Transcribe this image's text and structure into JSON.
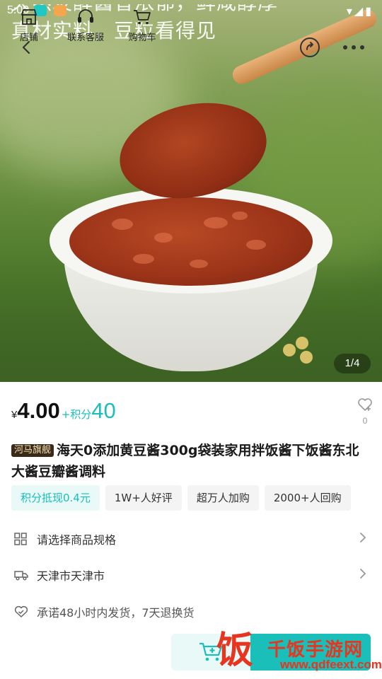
{
  "status_bar": {
    "time": "5:00"
  },
  "hero": {
    "headline_line1": "天然发酵酱香浓郁，鲜咸醇厚",
    "headline_line2": "真材实料，豆粒看得见",
    "image_counter": "1/4"
  },
  "product": {
    "currency": "¥",
    "price": "4.00",
    "points_plus": "+积分",
    "points": "40",
    "favorite_count": "0",
    "store_badge": "河马旗舰",
    "title": "海天0添加黄豆酱300g袋装家用拌饭酱下饭酱东北大酱豆瓣酱调料",
    "tags": [
      "积分抵现0.4元",
      "1W+人好评",
      "超万人加购",
      "2000+人回购"
    ]
  },
  "rows": {
    "spec": "请选择商品规格",
    "address": "天津市天津市",
    "promise": "承诺48小时内发货，7天退换货"
  },
  "bottom_bar": {
    "store": "店铺",
    "service": "联系客服",
    "cart": "购物车"
  },
  "watermark": {
    "big_char": "饭",
    "name": "千饭手游网",
    "url": "www.qdfeext.com"
  },
  "colors": {
    "accent": "#19bfb8",
    "badge_bg": "#3a2a1a",
    "watermark": "#e8351f"
  },
  "icons": [
    "back-icon",
    "share-icon",
    "more-icon",
    "heart-icon",
    "grid-icon",
    "truck-icon",
    "heart-check-icon",
    "chevron-right-icon",
    "store-icon",
    "headset-icon",
    "cart-icon",
    "cart-add-icon"
  ]
}
